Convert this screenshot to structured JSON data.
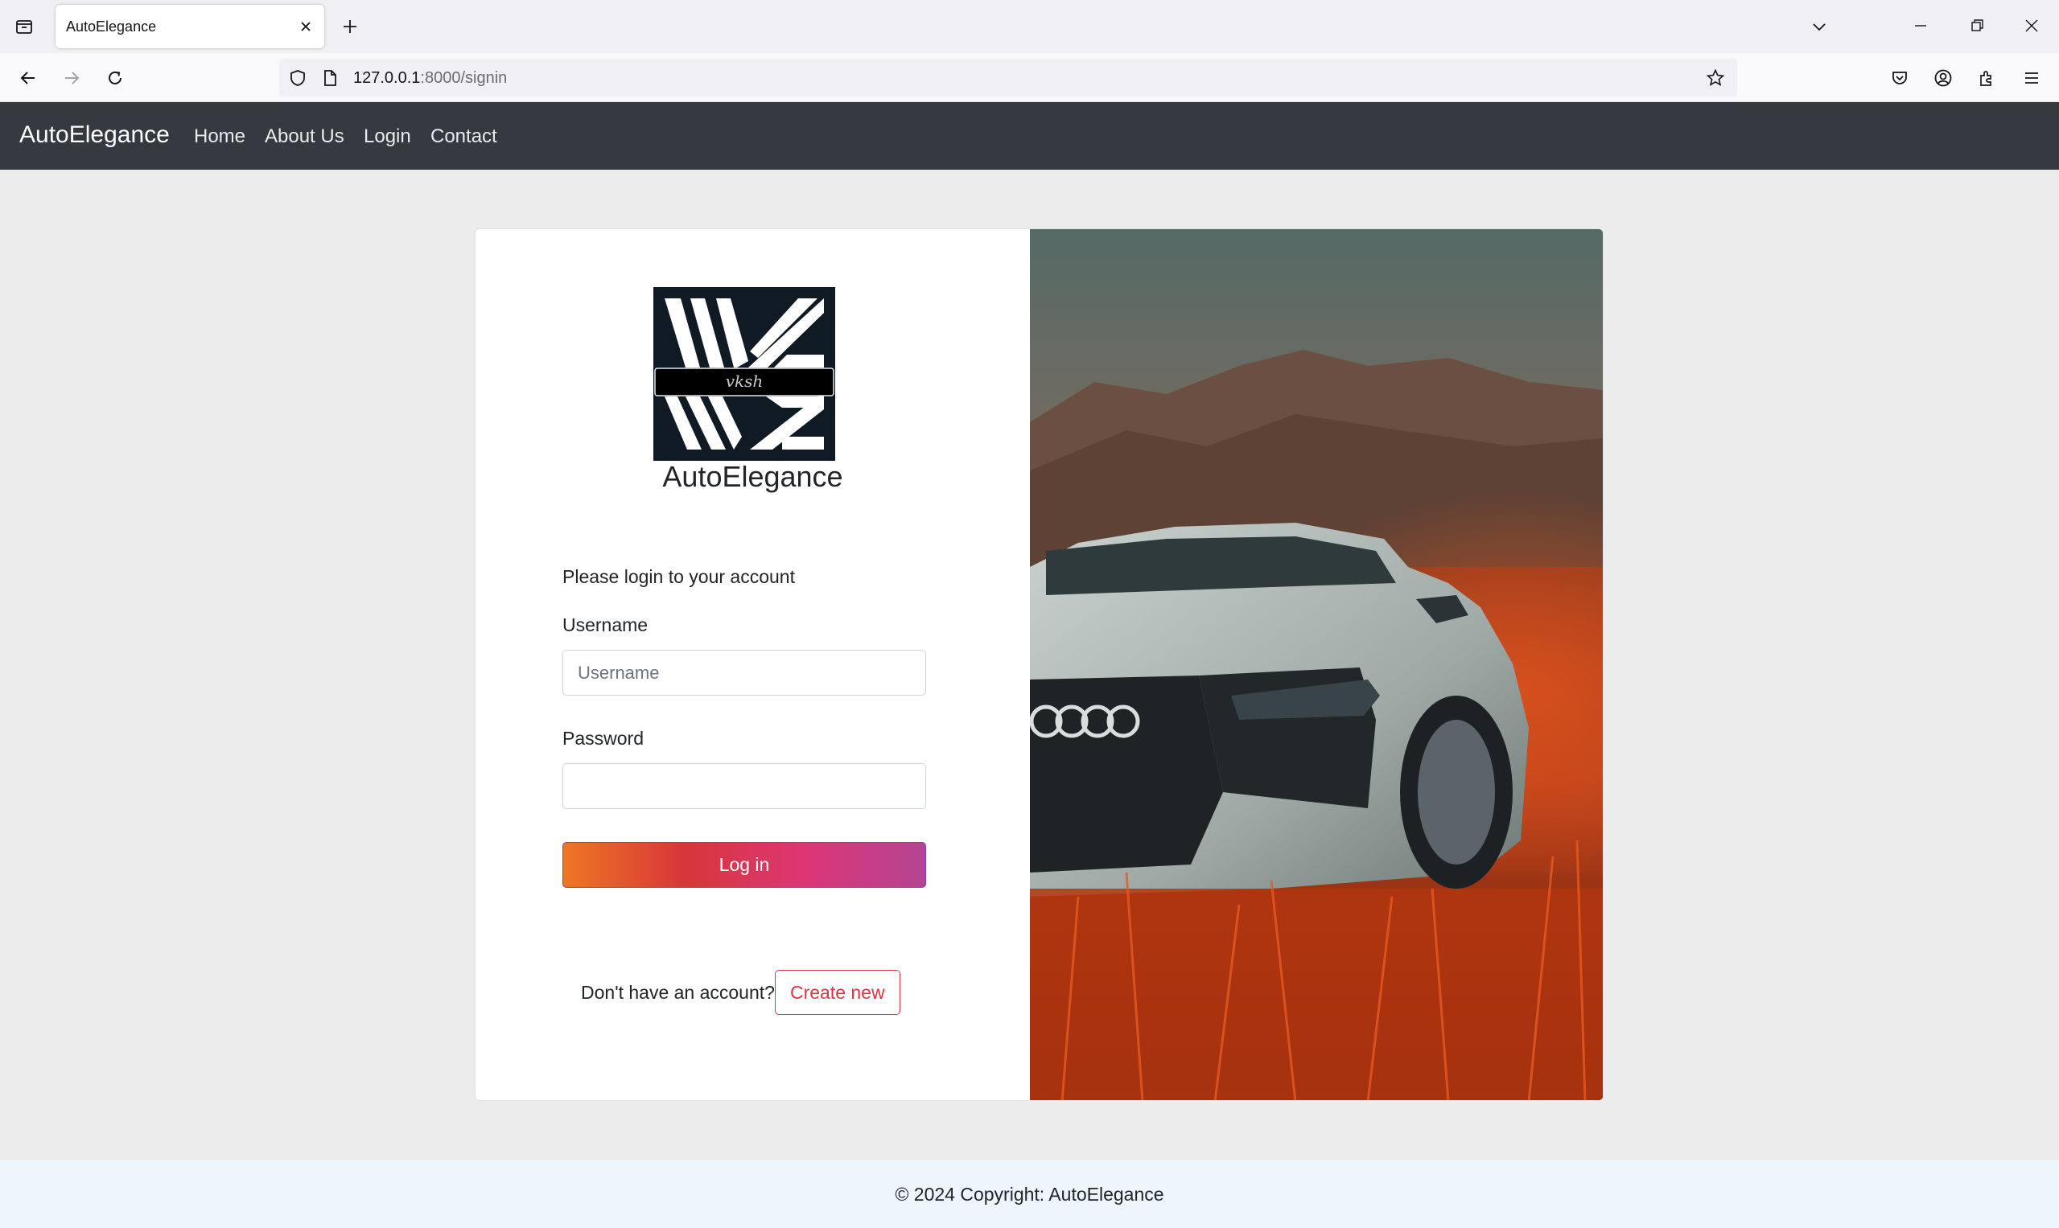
{
  "browser": {
    "tab_title": "AutoElegance",
    "url_host": "127.0.0.1",
    "url_path": ":8000/signin"
  },
  "site": {
    "brand": "AutoElegance",
    "nav": [
      "Home",
      "About Us",
      "Login",
      "Contact"
    ]
  },
  "login": {
    "logo_tag": "vksh",
    "logo_caption": "AutoElegance",
    "prompt": "Please login to your account",
    "username_label": "Username",
    "username_placeholder": "Username",
    "username_value": "",
    "password_label": "Password",
    "password_value": "",
    "submit_label": "Log in",
    "signup_text": "Don't have an account?",
    "signup_button": "Create new"
  },
  "footer": {
    "text": "© 2024 Copyright: AutoElegance"
  },
  "colors": {
    "navbar": "#343a40",
    "page_bg": "#ececec",
    "gradient": [
      "#ee7724",
      "#d8363a",
      "#dd3675",
      "#b44593"
    ],
    "danger": "#dc3545",
    "footer_bg": "#eef5fc"
  }
}
